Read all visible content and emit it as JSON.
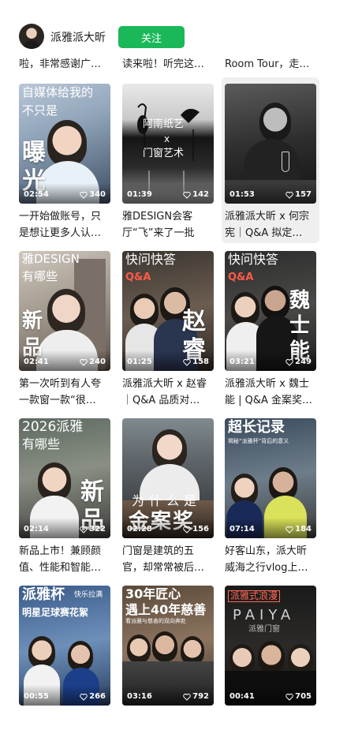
{
  "author": {
    "name": "派雅派大昕",
    "follow_label": "关注"
  },
  "top_captions": [
    "啦，非常感谢广…",
    "读来啦！听完这…",
    "Room Tour，走…"
  ],
  "videos": [
    {
      "duration": "02:54",
      "likes": "340",
      "overlay": [
        "自媒体给我的",
        "不只是",
        "曝",
        "光"
      ],
      "caption": "一开始做账号，只是想让更多人认…"
    },
    {
      "duration": "01:39",
      "likes": "142",
      "overlay": [
        "阿南纸艺",
        "x",
        "门窗艺术"
      ],
      "caption": "雅DESIGN会客厅“飞”来了一批小…"
    },
    {
      "duration": "01:53",
      "likes": "157",
      "overlay": [],
      "caption": "派雅派大昕 x 何宗宪｜Q&A 拟定…"
    },
    {
      "duration": "02:41",
      "likes": "240",
      "overlay": [
        "雅DESIGN",
        "有哪些",
        "新",
        "品"
      ],
      "caption": "第一次听到有人夸一款窗一款“很…"
    },
    {
      "duration": "01:25",
      "likes": "158",
      "overlay": [
        "快问快答",
        "Q&A",
        "赵",
        "睿"
      ],
      "caption": "派雅派大昕 x 赵睿｜Q&A 品质对…"
    },
    {
      "duration": "03:21",
      "likes": "249",
      "overlay": [
        "快问快答",
        "Q&A",
        "魏",
        "士",
        "能"
      ],
      "caption": "派雅派大昕 x 魏士能 | Q&A 金案奖…"
    },
    {
      "duration": "02:14",
      "likes": "322",
      "overlay": [
        "2026派雅",
        "有哪些",
        "新",
        "品"
      ],
      "caption": "新品上市！兼顾颜值、性能和智能…"
    },
    {
      "duration": "02:28",
      "likes": "156",
      "overlay": [
        "为什么是",
        "金案奖"
      ],
      "caption": "门窗是建筑的五官，却常常被后…"
    },
    {
      "duration": "07:14",
      "likes": "184",
      "overlay": [
        "超长记录",
        "揭秘“派雅杯”背后的意义"
      ],
      "caption": "好客山东，派大昕威海之行vlog上…"
    },
    {
      "duration": "00:55",
      "likes": "266",
      "overlay": [
        "派雅杯",
        "快乐拉满",
        "明星足球赛花絮"
      ],
      "caption": ""
    },
    {
      "duration": "03:16",
      "likes": "792",
      "overlay": [
        "30年匠心",
        "遇上40年慈善",
        "看派雅与慈善的双向奔赴"
      ],
      "caption": ""
    },
    {
      "duration": "00:41",
      "likes": "705",
      "overlay": [
        "派雅式浪漫",
        "PAIYA",
        "派雅门窗"
      ],
      "caption": ""
    }
  ]
}
